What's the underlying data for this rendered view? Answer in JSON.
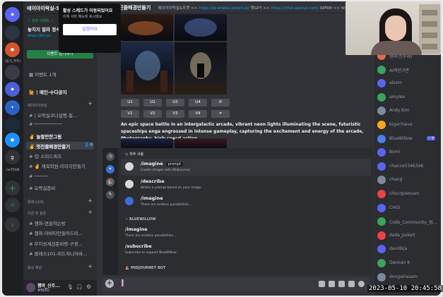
{
  "server_rail": {
    "labels": [
      "(동기_부트)",
      "(ㅂ러의세"
    ]
  },
  "sidebar": {
    "server_name": "에이아이락실-SELFISH CL...",
    "promo_line1": "☆ 한정 이벤트 ☆",
    "promo_line2": "놓치지 말라 정석하 ...",
    "promo_line3": "https://bit.ly/...",
    "event_button": "이벤트 참가하기",
    "events_count": "이벤트 1개",
    "channels": [
      {
        "label": "🙋 | 메인-수다공지",
        "bold": true
      },
      {
        "label": "에이아이락실"
      },
      {
        "label": "# | 오락실코너설명-필..."
      },
      {
        "label": "# ──────────"
      },
      {
        "label": "✌️ 놀랄만한그림"
      },
      {
        "label": "✌️ 멋진줄배경만들기",
        "active": true
      },
      {
        "label": "# 😊 스피드퀴즈"
      },
      {
        "label": "# ✌️ 재목학원-이미지만들기"
      },
      {
        "label": "# ─────"
      },
      {
        "label": "# 오락실준비"
      }
    ],
    "categories": [
      "클래스101",
      "이론 및 질문"
    ],
    "class_channels": [
      "# 챔마-연습하는방",
      "# 챔마-아바타만들어드리...",
      "# 무지성세션준비방-구경...",
      "# 클래스101-미드저니아바..."
    ],
    "voice_category": "음성 채널",
    "user_name": "챔마_신주...",
    "user_status": "#8660"
  },
  "tooltip": {
    "title": "활성 스레드가 이동되었어요",
    "body": "이제 서버 메뉴에 표시돼요",
    "button": "알겠어요"
  },
  "header": {
    "channel": "멋진줄배경만들기",
    "topic_prefix": "에이아이락실&포켓 >> ",
    "topic_link1": "https://ai-wrakai.pokeit.ai/",
    "topic_mid": " 챗GPT >> ",
    "topic_link2": "https://chat.openai.com/",
    "topic_tail": " AIPRM >> https"
  },
  "mj_buttons": {
    "row1": [
      "U1",
      "U2",
      "U3",
      "U4",
      "⟳"
    ],
    "row2": [
      "V1",
      "V2",
      "V3",
      "V4",
      "⌗"
    ]
  },
  "prompt_text": "An epic space battle in an intergalactic arcade, vibrant neon lights illuminating the scene, futuristic spaceships enga engrossed in intense gameplay, capturing the excitement and energy of the arcade, Photography, high-speed action",
  "popup": {
    "section_frequent": "자주 사용",
    "commands_frequent": [
      {
        "name": "/imagine",
        "option": "prompt",
        "desc": "Create images with Midjourney"
      },
      {
        "name": "/describe",
        "desc": "Writes a prompt based on your image."
      },
      {
        "name": "/imagine",
        "desc": "There are endless possibilities..."
      }
    ],
    "section_bluewillow": "BLUEWILLOW",
    "commands_bluewillow": [
      {
        "name": "/imagine",
        "desc": "There are endless possibilities..."
      },
      {
        "name": "/subscribe",
        "desc": "Subscribe to support BlueWillow"
      }
    ],
    "section_mj": "MIDJOURNEY BOT"
  },
  "members": [
    {
      "name": "챔마(신주혜)",
      "color": "#e26b4b"
    },
    {
      "name": "AI액션가면",
      "color": "#3ba55c"
    },
    {
      "name": "alsxm",
      "color": "#5865f2"
    },
    {
      "name": "amylee",
      "color": "#3ba55c"
    },
    {
      "name": "Andy Kim",
      "color": "#7d8a9a"
    },
    {
      "name": "bigachieve",
      "color": "#faa61a"
    },
    {
      "name": "BlueWillow",
      "color": "#4f7df0",
      "badge": "✓ 봇"
    },
    {
      "name": "Bomi",
      "color": "#5865f2"
    },
    {
      "name": "chance5346346",
      "color": "#5865f2"
    },
    {
      "name": "chang",
      "color": "#7d8a9a"
    },
    {
      "name": "chocopiessam",
      "color": "#ed4245"
    },
    {
      "name": "CHOI",
      "color": "#5865f2"
    },
    {
      "name": "Code_Community_팀...",
      "color": "#3ba55c"
    },
    {
      "name": "dada_pokeit",
      "color": "#ed4245"
    },
    {
      "name": "davidkja",
      "color": "#5865f2"
    },
    {
      "name": "Demian K",
      "color": "#3ba55c"
    },
    {
      "name": "dongwhasam",
      "color": "#7d8a9a"
    }
  ],
  "timestamp": "2023-05-10 20:45:58"
}
